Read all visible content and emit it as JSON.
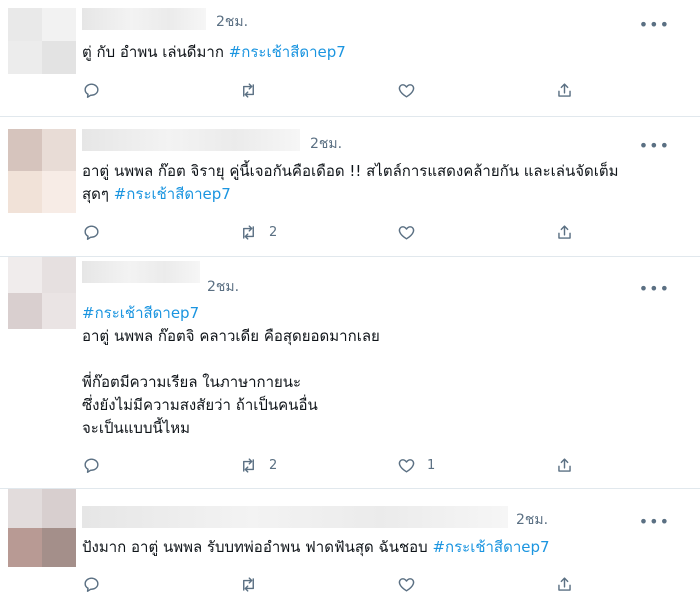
{
  "time_label": "2ชม.",
  "more_label": "•••",
  "tweets": [
    {
      "segments": [
        "ตู่ กับ อำพน เล่นดีมาก ",
        "#กระเช้าสีดาep7"
      ],
      "reply_count": "",
      "retweet_count": "",
      "like_count": ""
    },
    {
      "segments": [
        "อาตู่ นพพล ก๊อต จิรายุ คู่นี้เจอกันคือเดือด !! สไตล์การแสดงคล้ายกัน และเล่นจัดเต็ม\nสุดๆ ",
        "#กระเช้าสีดาep7"
      ],
      "reply_count": "",
      "retweet_count": "2",
      "like_count": ""
    },
    {
      "segments": [
        "#กระเช้าสีดาep7",
        "\nอาตู่ นพพล ก๊อตจิ คลาวเดีย คือสุดยอดมากเลย\n\nพี่ก๊อตมีความเรียล ในภาษากายนะ\nซึ่งยังไม่มีความสงสัยว่า ถ้าเป็นคนอื่น\nจะเป็นแบบนี้ไหม"
      ],
      "reply_count": "",
      "retweet_count": "2",
      "like_count": "1"
    },
    {
      "segments": [
        "ปังมาก อาตู่ นพพล รับบทพ่ออำพน ฟาดฟันสุด ฉันชอบ ",
        "#กระเช้าสีดาep7"
      ],
      "reply_count": "",
      "retweet_count": "",
      "like_count": ""
    }
  ],
  "colors": {
    "hashtag": "#1b95e0",
    "muted": "#5b7083",
    "divider": "#e1e8ed"
  },
  "icons": [
    "reply-icon",
    "retweet-icon",
    "like-icon",
    "share-icon"
  ]
}
